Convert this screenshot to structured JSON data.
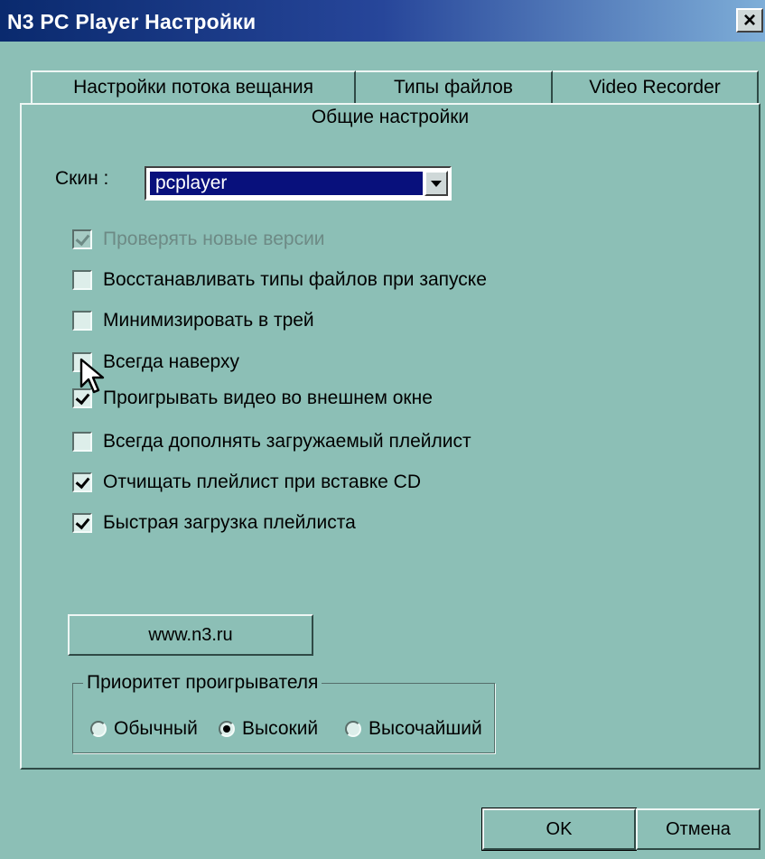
{
  "window": {
    "title": "N3 PC Player Настройки",
    "close_symbol": "×"
  },
  "tabs": [
    {
      "label": "Настройки потока вещания"
    },
    {
      "label": "Типы файлов"
    },
    {
      "label": "Video Recorder"
    }
  ],
  "panel": {
    "title": "Общие настройки"
  },
  "skin": {
    "label": "Скин :",
    "value": "pcplayer"
  },
  "options": [
    {
      "label": "Проверять новые версии",
      "checked": true,
      "disabled": true
    },
    {
      "label": "Восстанавливать типы файлов при запуске",
      "checked": false,
      "disabled": false
    },
    {
      "label": "Минимизировать в трей",
      "checked": false,
      "disabled": false
    },
    {
      "label": "Всегда наверху",
      "checked": false,
      "disabled": false
    },
    {
      "label": "Проигрывать видео во внешнем окне",
      "checked": true,
      "disabled": false
    },
    {
      "label": "Всегда дополнять загружаемый плейлист",
      "checked": false,
      "disabled": false
    },
    {
      "label": "Отчищать плейлист при вставке CD",
      "checked": true,
      "disabled": false
    },
    {
      "label": "Быстрая загрузка плейлиста",
      "checked": true,
      "disabled": false
    }
  ],
  "website_button": "www.n3.ru",
  "priority": {
    "legend": "Приоритет проигрывателя",
    "options": [
      {
        "label": "Обычный",
        "selected": false
      },
      {
        "label": "Высокий",
        "selected": true
      },
      {
        "label": "Высочайший",
        "selected": false
      }
    ]
  },
  "footer": {
    "ok_label": "OK",
    "cancel_label": "Отмена"
  },
  "colors": {
    "background": "#8cbfb6",
    "title_bar_start": "#0a2a6e",
    "title_bar_end": "#7eaed8",
    "selection": "#08107c"
  }
}
